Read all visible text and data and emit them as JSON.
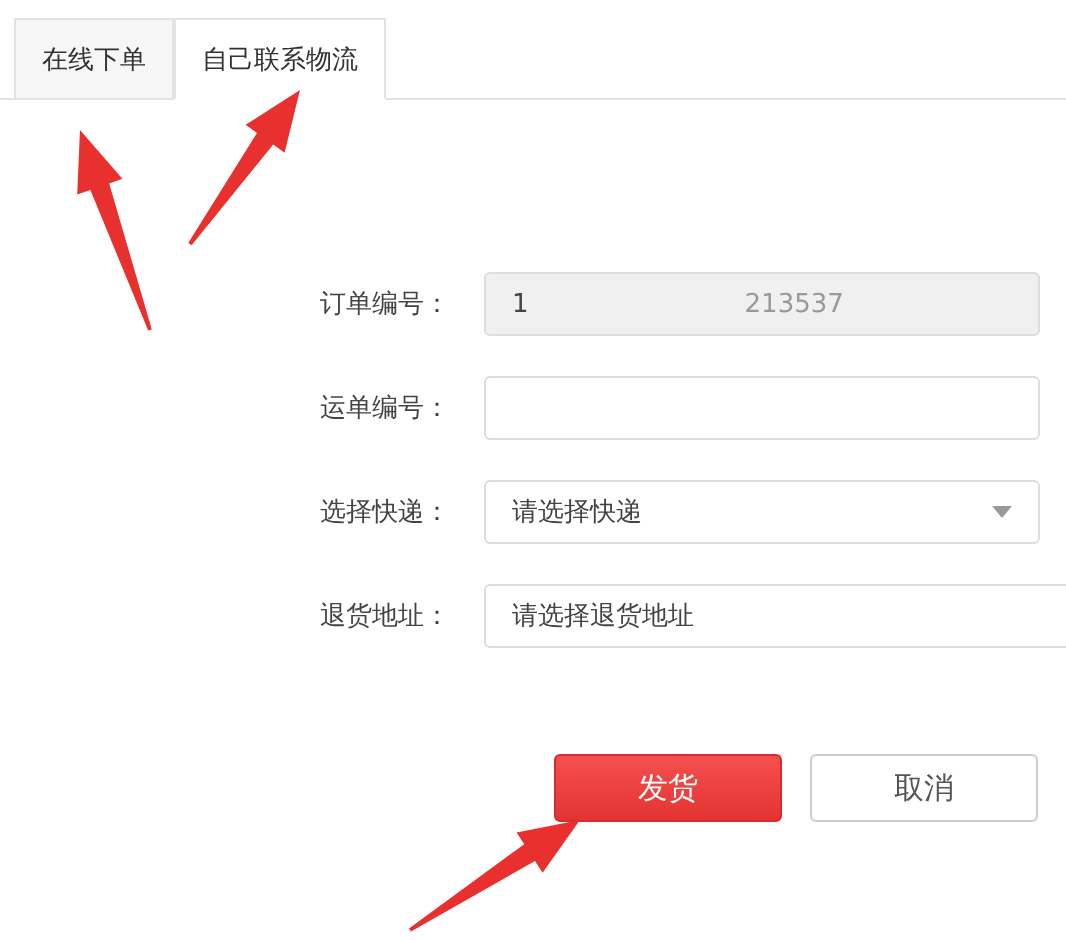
{
  "tabs": [
    {
      "label": "在线下单",
      "selected": false
    },
    {
      "label": "自己联系物流",
      "selected": true
    }
  ],
  "form": {
    "rows": [
      {
        "kind": "readonly",
        "label": "订单编号：",
        "value": "1",
        "value_tail": "213537"
      },
      {
        "kind": "text",
        "label": "运单编号："
      },
      {
        "kind": "select",
        "label": "选择快递：",
        "placeholder": "请选择快递"
      },
      {
        "kind": "picker",
        "label": "退货地址：",
        "placeholder": "请选择退货地址"
      }
    ]
  },
  "buttons": [
    {
      "label": "发货",
      "kind": "primary"
    },
    {
      "label": "取消",
      "kind": "default"
    }
  ]
}
